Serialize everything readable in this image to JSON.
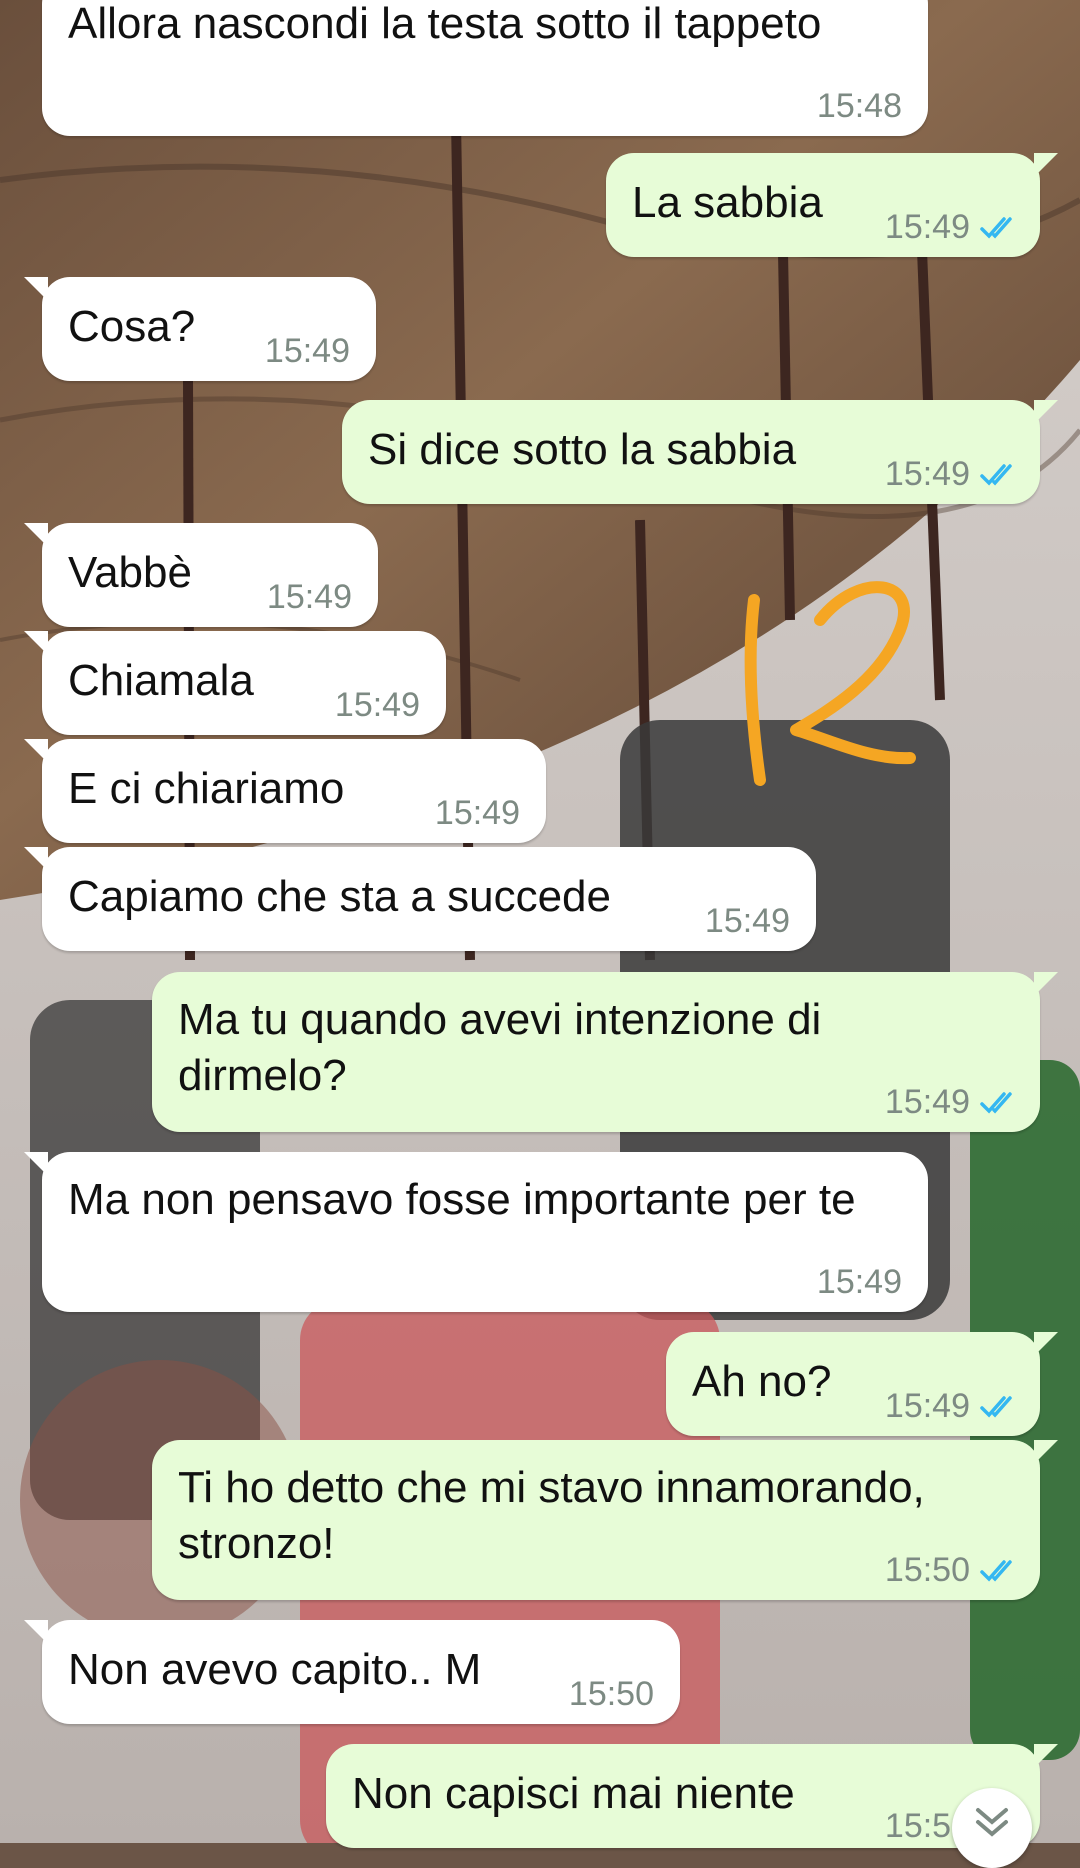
{
  "chat": {
    "messages": [
      {
        "direction": "incoming",
        "text": "Allora nascondi la testa sotto il tappeto",
        "time": "15:48"
      },
      {
        "direction": "outgoing",
        "text": "La sabbia",
        "time": "15:49",
        "status": "read"
      },
      {
        "direction": "incoming",
        "text": "Cosa?",
        "time": "15:49"
      },
      {
        "direction": "outgoing",
        "text": "Si dice sotto la sabbia",
        "time": "15:49",
        "status": "read"
      },
      {
        "direction": "incoming",
        "text": "Vabbè",
        "time": "15:49"
      },
      {
        "direction": "incoming",
        "text": "Chiamala",
        "time": "15:49"
      },
      {
        "direction": "incoming",
        "text": "E ci chiariamo",
        "time": "15:49"
      },
      {
        "direction": "incoming",
        "text": "Capiamo che sta a succede",
        "time": "15:49"
      },
      {
        "direction": "outgoing",
        "text": "Ma tu quando avevi intenzione di dirmelo?",
        "time": "15:49",
        "status": "read"
      },
      {
        "direction": "incoming",
        "text": "Ma non pensavo fosse importante per te",
        "time": "15:49"
      },
      {
        "direction": "outgoing",
        "text": "Ah no?",
        "time": "15:49",
        "status": "read"
      },
      {
        "direction": "outgoing",
        "text": "Ti ho detto che mi stavo innamorando, stronzo!",
        "time": "15:50",
        "status": "read"
      },
      {
        "direction": "incoming",
        "text": "Non avevo capito.. M",
        "time": "15:50"
      },
      {
        "direction": "outgoing",
        "text": "Non capisci mai niente",
        "time": "15:51",
        "status": "read"
      }
    ]
  },
  "icons": {
    "read_receipt": "double-check-icon",
    "scroll_down": "chevron-double-down-icon"
  },
  "colors": {
    "incoming_bubble": "#ffffff",
    "outgoing_bubble": "#e7fcd7",
    "timestamp": "#7d8a83",
    "read_tick": "#34b7f1",
    "scribble": "#f5a623"
  }
}
